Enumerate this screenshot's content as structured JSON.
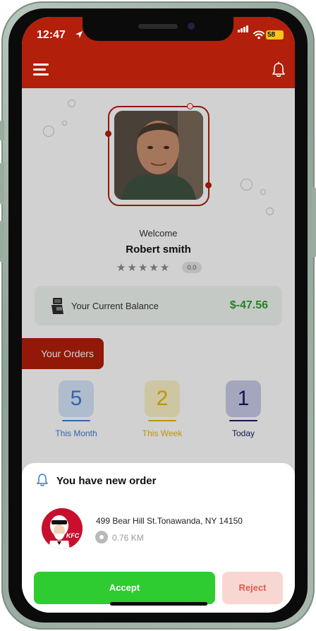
{
  "status_bar": {
    "time": "12:47",
    "battery": "58"
  },
  "profile": {
    "welcome": "Welcome",
    "name": "Robert smith",
    "stars": "★★★★★",
    "rating": "0.0"
  },
  "balance": {
    "label": "Your Current Balance",
    "amount": "$-47.56"
  },
  "orders": {
    "button_label": "Your Orders",
    "stats": [
      {
        "value": "5",
        "label": "This Month",
        "color": "#3d7ad4"
      },
      {
        "value": "2",
        "label": "This Week",
        "color": "#e8b800"
      },
      {
        "value": "1",
        "label": "Today",
        "color": "#1b1c5c"
      }
    ]
  },
  "new_order": {
    "title": "You have new order",
    "brand_logo_text": "KFC",
    "address": "499 Bear Hill St.Tonawanda, NY 14150",
    "distance": "0.76 KM",
    "accept_label": "Accept",
    "reject_label": "Reject"
  },
  "colors": {
    "brand_red": "#b21f0a",
    "accept_green": "#2ecc31",
    "balance_green": "#2e9e2e",
    "reject_bg": "#f8d7d3"
  },
  "icons": {
    "menu": "hamburger-menu-icon",
    "notification": "bell-icon",
    "wallet": "wallet-icon",
    "location": "location-pin-icon"
  }
}
